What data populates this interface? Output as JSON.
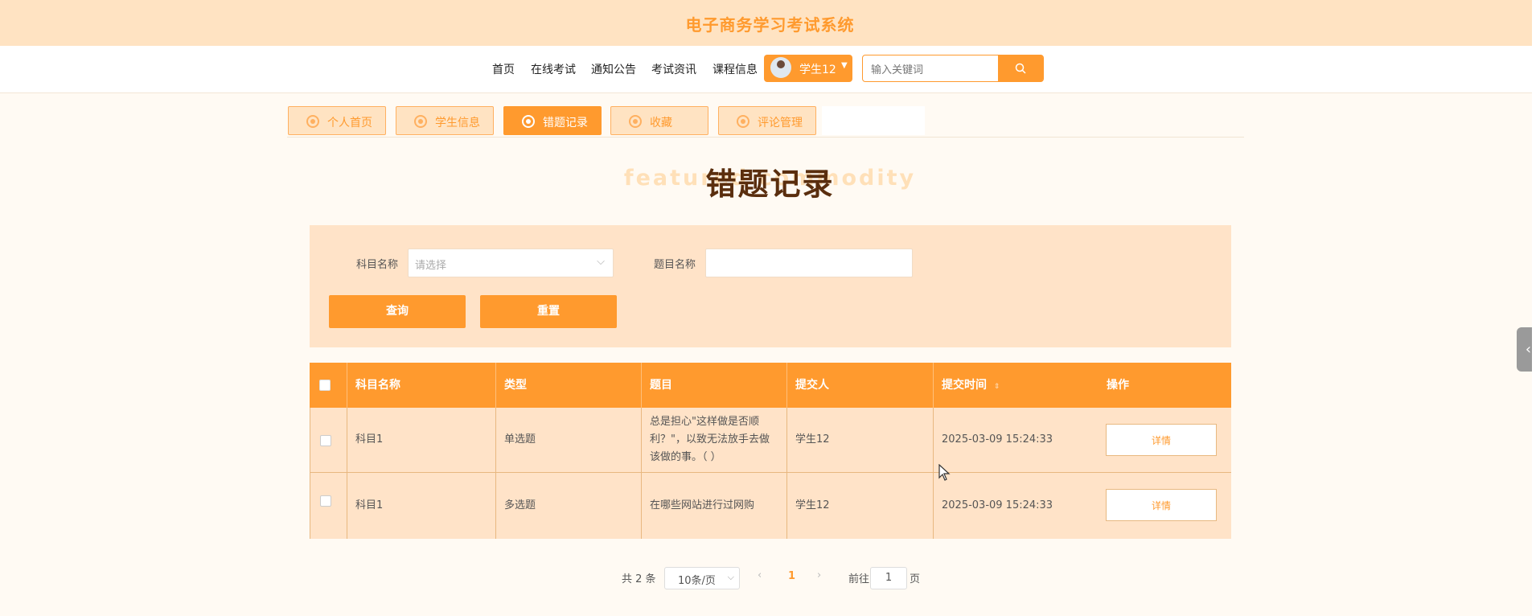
{
  "app_title": "电子商务学习考试系统",
  "nav": {
    "items": [
      "首页",
      "在线考试",
      "通知公告",
      "考试资讯",
      "课程信息"
    ],
    "user_name": "学生12",
    "search_placeholder": "输入关键词"
  },
  "tabs": [
    {
      "label": "个人首页",
      "active": false
    },
    {
      "label": "学生信息",
      "active": false
    },
    {
      "label": "错题记录",
      "active": true
    },
    {
      "label": "收藏",
      "active": false
    },
    {
      "label": "评论管理",
      "active": false
    }
  ],
  "page_heading": "错题记录",
  "heading_decor_text": "featured commodity",
  "filter": {
    "subject_label": "科目名称",
    "subject_placeholder": "请选择",
    "question_label": "题目名称",
    "question_value": "",
    "query_button": "查询",
    "reset_button": "重置"
  },
  "table": {
    "headers": [
      "科目名称",
      "类型",
      "题目",
      "提交人",
      "提交时间",
      "操作"
    ],
    "rows": [
      {
        "subject": "科目1",
        "type": "单选题",
        "question": "总是担心\"这样做是否顺利？\"，以致无法放手去做该做的事。（ ）",
        "submitter": "学生12",
        "time": "2025-03-09 15:24:33",
        "action": "详情"
      },
      {
        "subject": "科目1",
        "type": "多选题",
        "question": "在哪些网站进行过网购",
        "submitter": "学生12",
        "time": "2025-03-09 15:24:33",
        "action": "详情"
      }
    ]
  },
  "pagination": {
    "total_text": "共 2 条",
    "page_size": "10条/页",
    "current_page": "1",
    "goto_prefix": "前往",
    "goto_value": "1",
    "goto_suffix": "页"
  },
  "colors": {
    "accent": "#ff9a2e",
    "header_bg": "#ffe3c2",
    "heading": "#5a2e0e"
  }
}
